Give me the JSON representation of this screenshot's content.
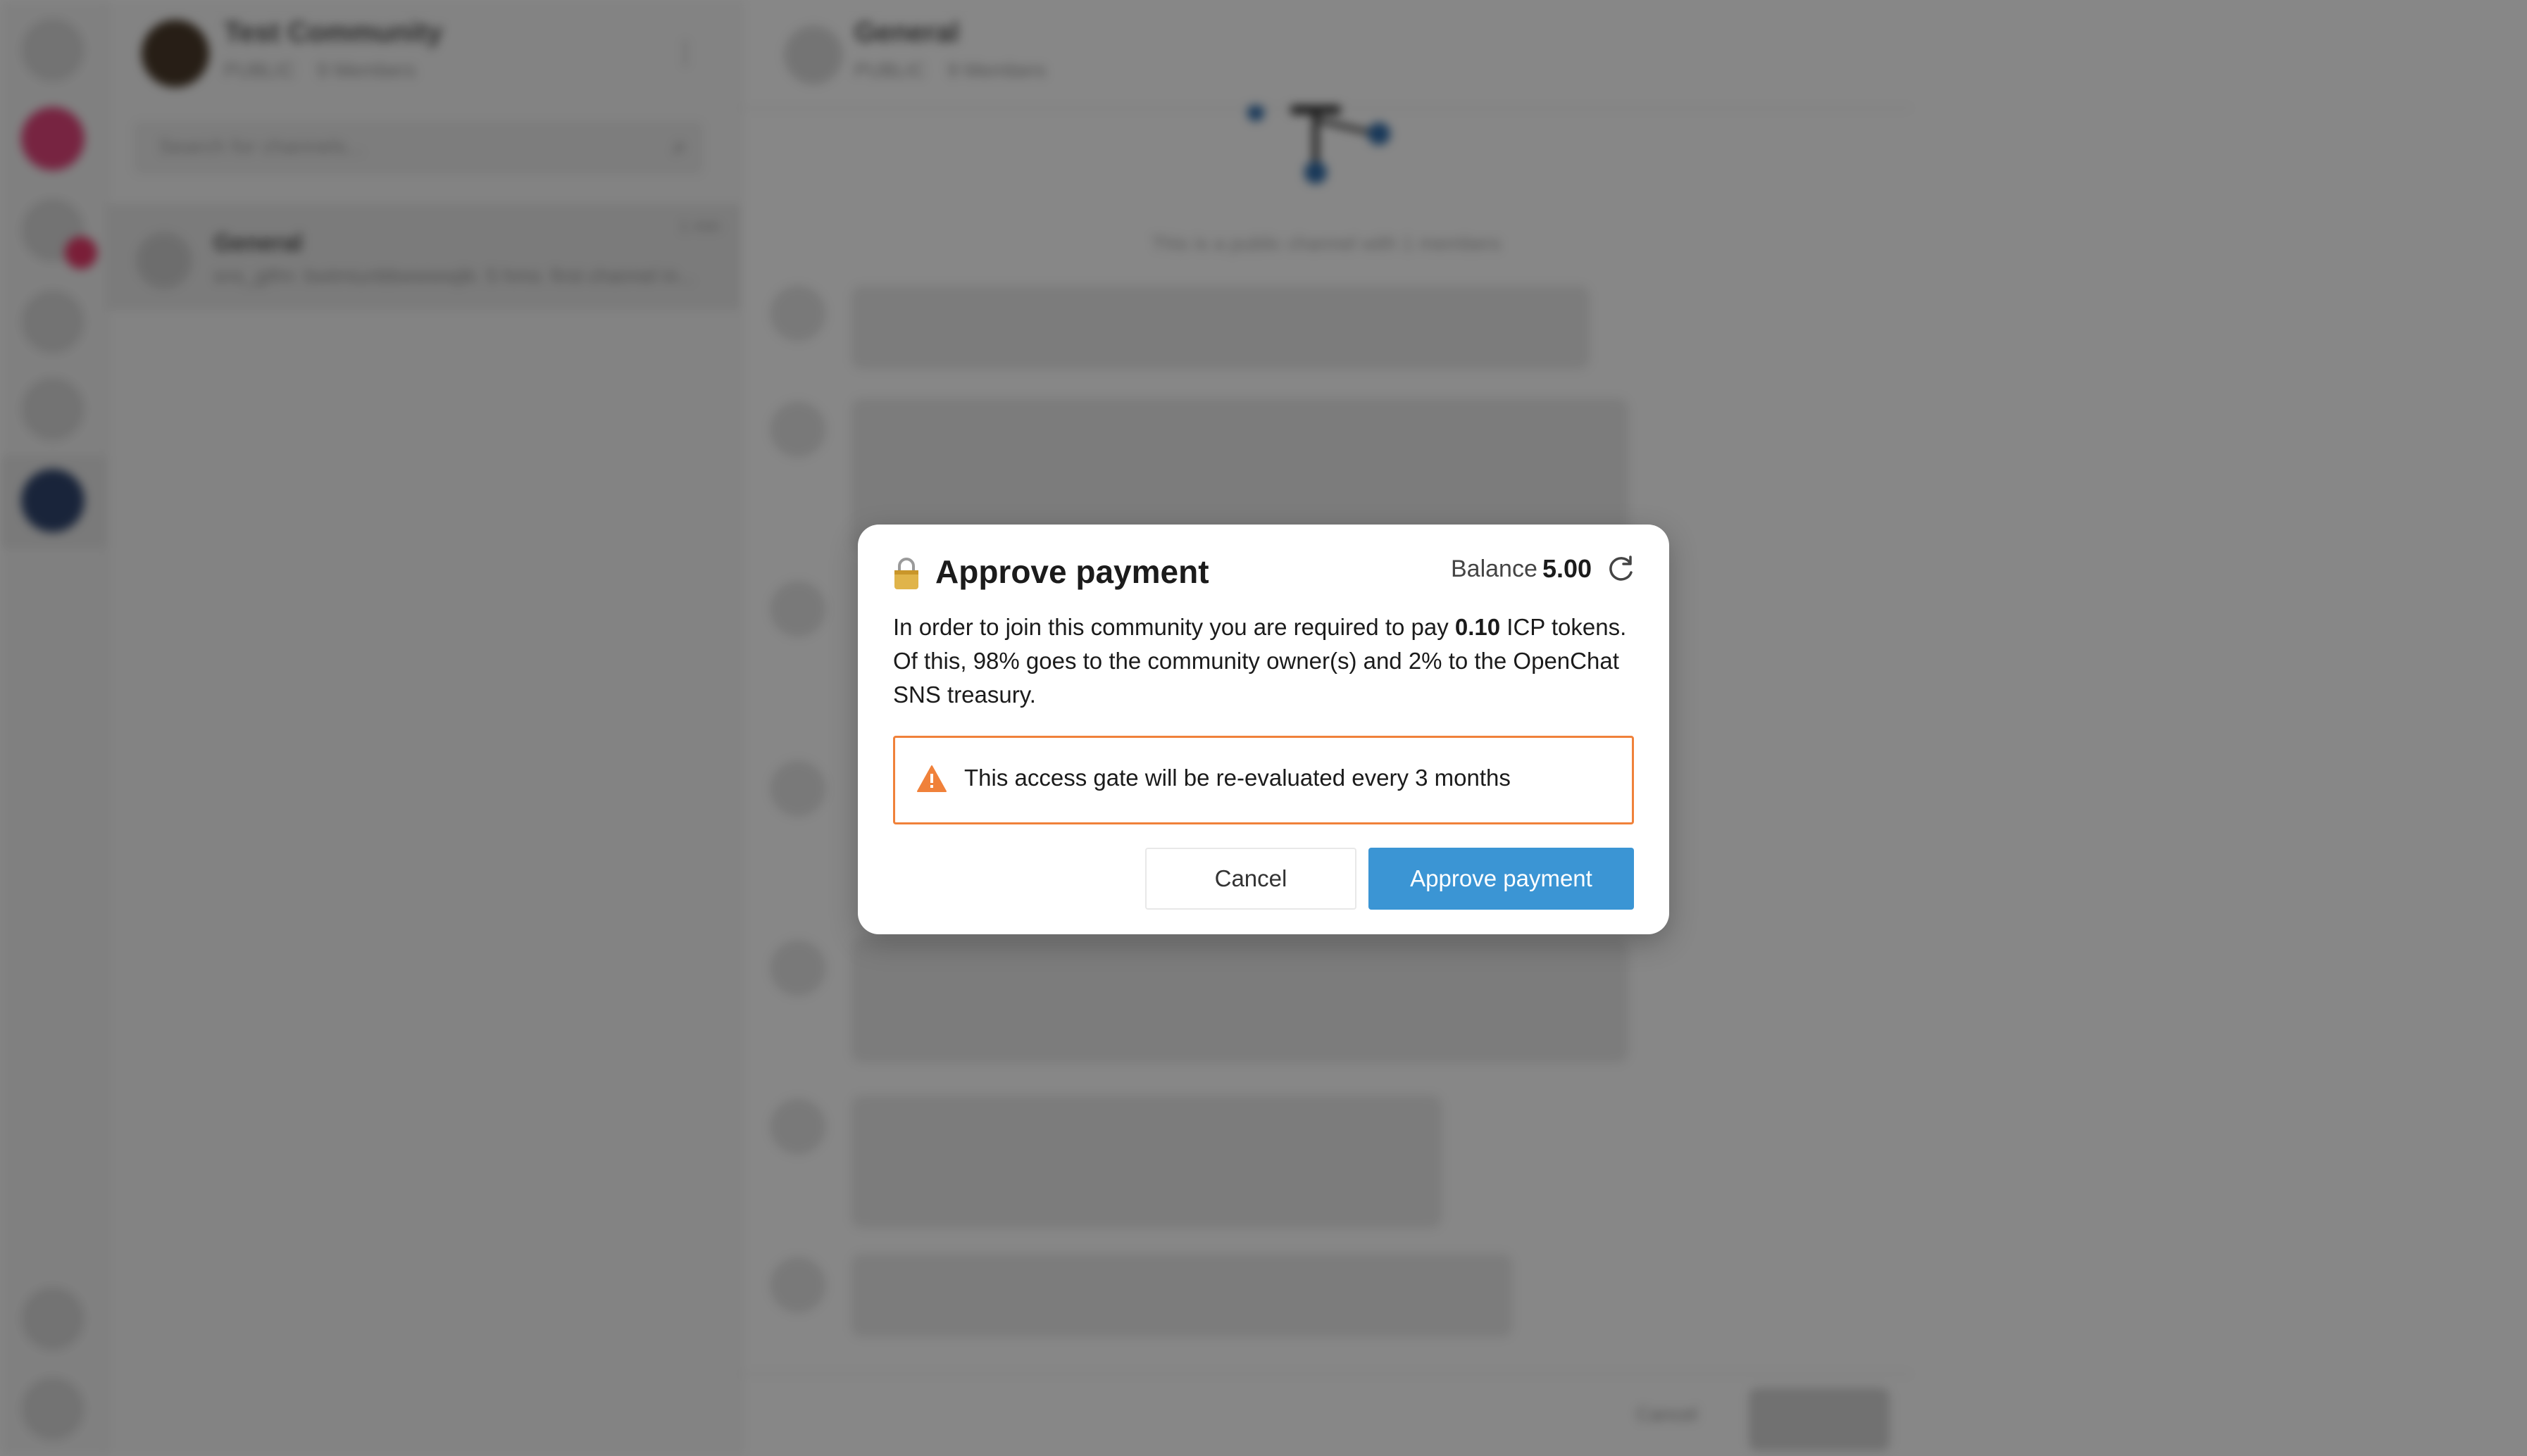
{
  "background": {
    "community": {
      "name": "Test Community",
      "public_badge": "PUBLIC",
      "members": "9 Members"
    },
    "search": {
      "placeholder": "Search for channels..."
    },
    "channel_item": {
      "name": "General",
      "last_message": "sns_gtfm: bwtmiunbbwwwwjik: 5 hms: first channel in...",
      "time": "1 min"
    },
    "chat_header": {
      "title": "General",
      "public_badge": "PUBLIC",
      "members": "9 Members"
    },
    "info_line": "This is a public channel with 1 members",
    "composer": {
      "cancel_label": "Cancel"
    }
  },
  "modal": {
    "title": "Approve payment",
    "balance_label": "Balance",
    "balance_value": "5.00",
    "description_prefix": "In order to join this community you are required to pay ",
    "amount": "0.10",
    "description_suffix": " ICP tokens. Of this, 98% goes to the community owner(s) and 2% to the OpenChat SNS treasury.",
    "warning": "This access gate will be re-evaluated every 3 months",
    "cancel_label": "Cancel",
    "approve_label": "Approve payment"
  },
  "colors": {
    "accent": "#3b95d4",
    "warning": "#f0813a",
    "overlay": "rgba(0,0,0,0.47)"
  },
  "icons": {
    "title_icon": "lock-icon",
    "refresh": "refresh-icon",
    "warning": "warning-icon"
  }
}
